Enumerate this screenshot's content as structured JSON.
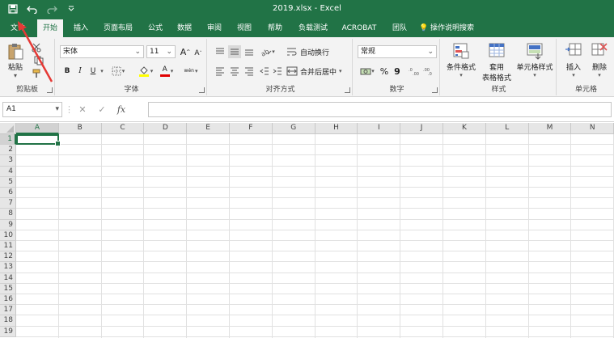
{
  "window": {
    "title": "2019.xlsx  -  Excel"
  },
  "qat": {
    "icons": [
      "save-icon",
      "undo-icon",
      "redo-icon",
      "customize-icon"
    ]
  },
  "tabs": [
    "文件",
    "开始",
    "插入",
    "页面布局",
    "公式",
    "数据",
    "审阅",
    "视图",
    "帮助",
    "负载测试",
    "ACROBAT",
    "团队",
    "操作说明搜索"
  ],
  "active_tab": "开始",
  "ribbon": {
    "clipboard": {
      "label": "剪贴板",
      "paste": "粘贴"
    },
    "font": {
      "label": "字体",
      "font_name": "宋体",
      "font_size": "11",
      "grow": "A",
      "shrink": "A",
      "bold": "B",
      "italic": "I",
      "underline": "U",
      "font_color_letter": "A",
      "phonetic": "wén"
    },
    "alignment": {
      "label": "对齐方式",
      "wrap": "自动换行",
      "merge": "合并后居中"
    },
    "number": {
      "label": "数字",
      "format": "常规",
      "percent": "%",
      "comma": "9"
    },
    "styles": {
      "label": "样式",
      "conditional": "条件格式",
      "table_format_1": "套用",
      "table_format_2": "表格格式",
      "cell_styles": "单元格样式"
    },
    "cells": {
      "label": "单元格",
      "insert": "插入",
      "delete": "删除"
    }
  },
  "formula_bar": {
    "name_box": "A1",
    "cancel": "✕",
    "enter": "✓",
    "fx": "fx",
    "formula": ""
  },
  "grid": {
    "columns": [
      "A",
      "B",
      "C",
      "D",
      "E",
      "F",
      "G",
      "H",
      "I",
      "J",
      "K",
      "L",
      "M",
      "N"
    ],
    "rows": [
      "1",
      "2",
      "3",
      "4",
      "5",
      "6",
      "7",
      "8",
      "9",
      "10",
      "11",
      "12",
      "13",
      "14",
      "15",
      "16",
      "17",
      "18",
      "19"
    ],
    "selected_cell": "A1"
  },
  "colors": {
    "accent": "#217346",
    "annotation": "#e53935"
  }
}
